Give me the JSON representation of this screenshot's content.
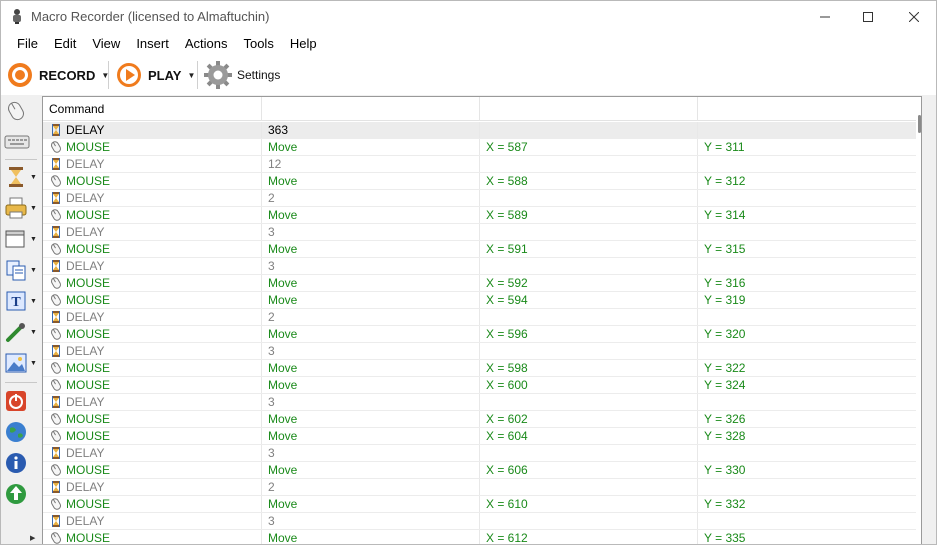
{
  "window": {
    "title": "Macro Recorder (licensed to Almaftuchin)"
  },
  "menu": {
    "items": [
      "File",
      "Edit",
      "View",
      "Insert",
      "Actions",
      "Tools",
      "Help"
    ]
  },
  "toolbar": {
    "record_label": "RECORD",
    "play_label": "PLAY",
    "settings_label": "Settings"
  },
  "sidebar": {
    "icons": [
      "mouse-icon",
      "keyboard-icon",
      "hourglass-icon",
      "printer-icon",
      "window-icon",
      "clipboard-icon",
      "text-icon",
      "eyedropper-icon",
      "image-icon",
      "power-icon",
      "globe-icon",
      "info-icon",
      "recycle-icon"
    ]
  },
  "grid": {
    "columns": [
      "Command",
      "",
      "",
      ""
    ],
    "rows": [
      {
        "type": "delay",
        "command": "DELAY",
        "p1": "363",
        "p2": "",
        "p3": ""
      },
      {
        "type": "mouse",
        "command": "MOUSE",
        "p1": "Move",
        "p2": "X = 587",
        "p3": "Y = 311"
      },
      {
        "type": "delay",
        "command": "DELAY",
        "p1": "12",
        "p2": "",
        "p3": ""
      },
      {
        "type": "mouse",
        "command": "MOUSE",
        "p1": "Move",
        "p2": "X = 588",
        "p3": "Y = 312"
      },
      {
        "type": "delay",
        "command": "DELAY",
        "p1": "2",
        "p2": "",
        "p3": ""
      },
      {
        "type": "mouse",
        "command": "MOUSE",
        "p1": "Move",
        "p2": "X = 589",
        "p3": "Y = 314"
      },
      {
        "type": "delay",
        "command": "DELAY",
        "p1": "3",
        "p2": "",
        "p3": ""
      },
      {
        "type": "mouse",
        "command": "MOUSE",
        "p1": "Move",
        "p2": "X = 591",
        "p3": "Y = 315"
      },
      {
        "type": "delay",
        "command": "DELAY",
        "p1": "3",
        "p2": "",
        "p3": ""
      },
      {
        "type": "mouse",
        "command": "MOUSE",
        "p1": "Move",
        "p2": "X = 592",
        "p3": "Y = 316"
      },
      {
        "type": "mouse",
        "command": "MOUSE",
        "p1": "Move",
        "p2": "X = 594",
        "p3": "Y = 319"
      },
      {
        "type": "delay",
        "command": "DELAY",
        "p1": "2",
        "p2": "",
        "p3": ""
      },
      {
        "type": "mouse",
        "command": "MOUSE",
        "p1": "Move",
        "p2": "X = 596",
        "p3": "Y = 320"
      },
      {
        "type": "delay",
        "command": "DELAY",
        "p1": "3",
        "p2": "",
        "p3": ""
      },
      {
        "type": "mouse",
        "command": "MOUSE",
        "p1": "Move",
        "p2": "X = 598",
        "p3": "Y = 322"
      },
      {
        "type": "mouse",
        "command": "MOUSE",
        "p1": "Move",
        "p2": "X = 600",
        "p3": "Y = 324"
      },
      {
        "type": "delay",
        "command": "DELAY",
        "p1": "3",
        "p2": "",
        "p3": ""
      },
      {
        "type": "mouse",
        "command": "MOUSE",
        "p1": "Move",
        "p2": "X = 602",
        "p3": "Y = 326"
      },
      {
        "type": "mouse",
        "command": "MOUSE",
        "p1": "Move",
        "p2": "X = 604",
        "p3": "Y = 328"
      },
      {
        "type": "delay",
        "command": "DELAY",
        "p1": "3",
        "p2": "",
        "p3": ""
      },
      {
        "type": "mouse",
        "command": "MOUSE",
        "p1": "Move",
        "p2": "X = 606",
        "p3": "Y = 330"
      },
      {
        "type": "delay",
        "command": "DELAY",
        "p1": "2",
        "p2": "",
        "p3": ""
      },
      {
        "type": "mouse",
        "command": "MOUSE",
        "p1": "Move",
        "p2": "X = 610",
        "p3": "Y = 332"
      },
      {
        "type": "delay",
        "command": "DELAY",
        "p1": "3",
        "p2": "",
        "p3": ""
      },
      {
        "type": "mouse",
        "command": "MOUSE",
        "p1": "Move",
        "p2": "X = 612",
        "p3": "Y = 335"
      }
    ]
  },
  "colors": {
    "delay_text": "#808080",
    "mouse_text": "#1a8a1a",
    "record_orange": "#f07b1d",
    "play_orange": "#f07b1d"
  }
}
